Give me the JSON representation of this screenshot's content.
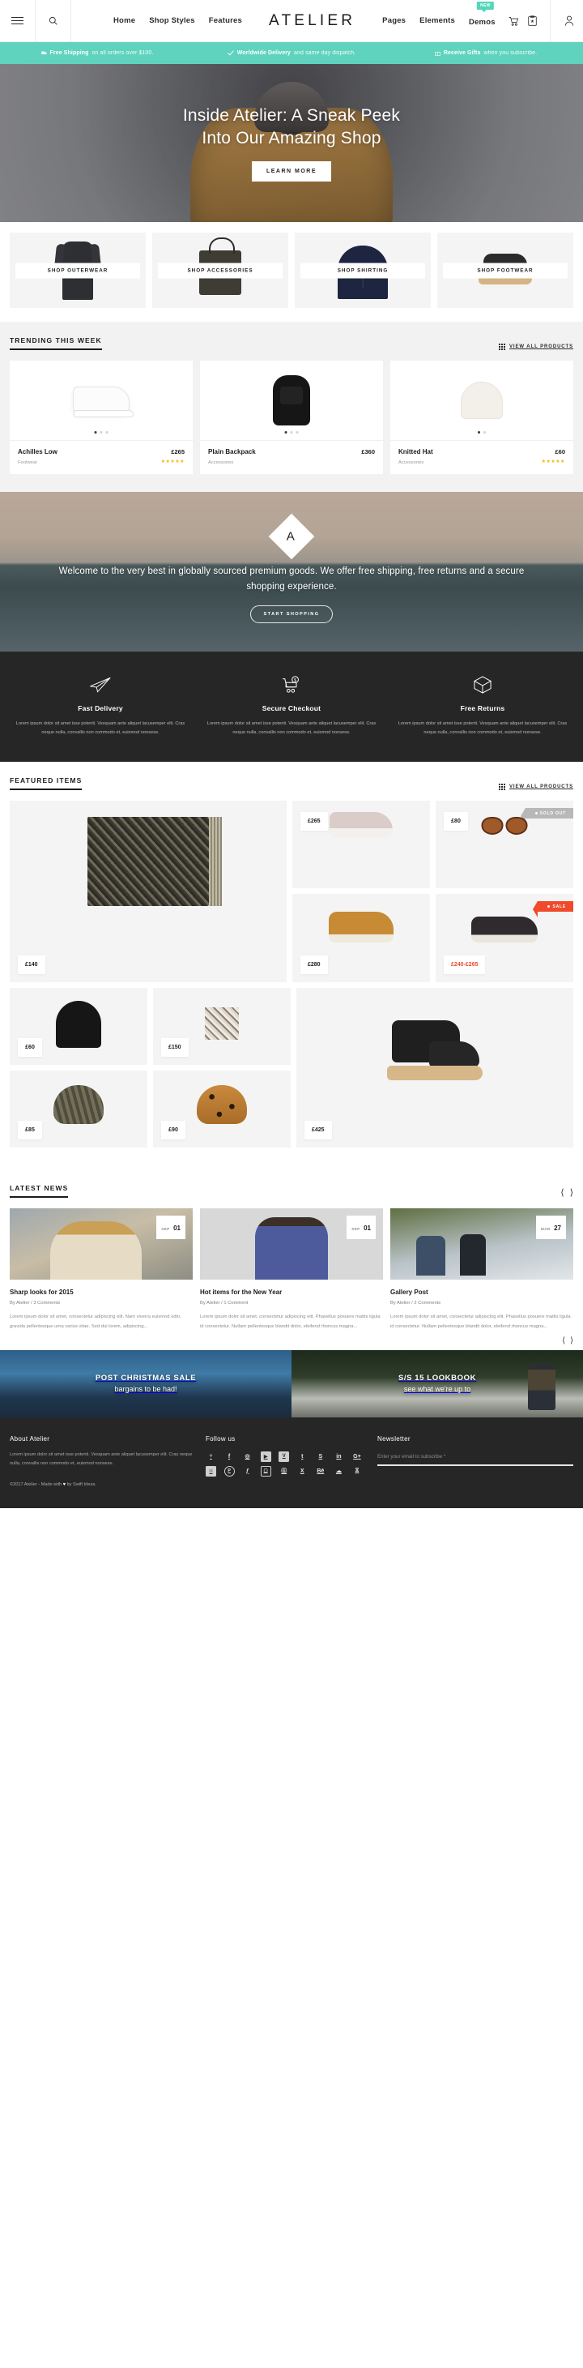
{
  "header": {
    "menu_icon": "hamburger-icon",
    "search_icon": "search-icon",
    "nav": [
      {
        "label": "Home"
      },
      {
        "label": "Shop Styles"
      },
      {
        "label": "Features"
      },
      {
        "label": "Pages"
      },
      {
        "label": "Elements"
      },
      {
        "label": "Demos",
        "badge": "NEW"
      }
    ],
    "brand": "ATELIER",
    "cart_icon": "shopping-cart-icon",
    "wishlist_icon": "clipboard-star-icon",
    "account_icon": "user-account-icon"
  },
  "promo_strip": {
    "items": [
      {
        "icon": "truck-icon",
        "bold": "Free Shipping",
        "rest": "on all orders over $100."
      },
      {
        "icon": "check-icon",
        "bold": "Worldwide Delivery",
        "rest": "and same day dispatch."
      },
      {
        "icon": "gift-icon",
        "bold": "Receive Gifts",
        "rest": "when you subscribe."
      }
    ]
  },
  "hero": {
    "line1": "Inside Atelier: A Sneak Peek",
    "line2": "Into Our Amazing Shop",
    "button": "LEARN MORE"
  },
  "categories": [
    {
      "label": "SHOP OUTERWEAR",
      "art": "coat"
    },
    {
      "label": "SHOP ACCESSORIES",
      "art": "bag"
    },
    {
      "label": "SHOP SHIRTING",
      "art": "shirt"
    },
    {
      "label": "SHOP FOOTWEAR",
      "art": "boot"
    }
  ],
  "trending": {
    "title": "TRENDING THIS WEEK",
    "action": "VIEW ALL PRODUCTS",
    "products": [
      {
        "name": "Achilles Low",
        "price": "£265",
        "category": "Footwear",
        "stars": "★★★★★",
        "dots": 3,
        "active_dot": 0
      },
      {
        "name": "Plain Backpack",
        "price": "£360",
        "category": "Accessories",
        "stars": "",
        "dots": 3,
        "active_dot": 0
      },
      {
        "name": "Knitted Hat",
        "price": "£60",
        "category": "Accessories",
        "stars": "★★★★★",
        "dots": 2,
        "active_dot": 0
      }
    ]
  },
  "welcome": {
    "logo_letter": "A",
    "text": "Welcome to the very best in globally sourced premium goods. We offer free shipping, free returns and a secure shopping experience.",
    "button": "START SHOPPING"
  },
  "features": [
    {
      "icon": "paper-plane-icon",
      "title": "Fast Delivery",
      "body": "Lorem ipsum dolor sit amet isse potenti. Vesquam ante aliquet lacusemper elit. Cras neque nulla, convallis non commodo et, euismod nonsese."
    },
    {
      "icon": "secure-cart-icon",
      "title": "Secure Checkout",
      "body": "Lorem ipsum dolor sit amet isse potenti. Vesquam ante aliquet lacusemper elit. Cras neque nulla, convallis non commodo et, euismod nonsese."
    },
    {
      "icon": "open-box-icon",
      "title": "Free Returns",
      "body": "Lorem ipsum dolor sit amet isse potenti. Vesquam ante aliquet lacusemper elit. Cras neque nulla, convallis non commodo et, euismod nonsese."
    }
  ],
  "featured": {
    "title": "FEATURED ITEMS",
    "action": "VIEW ALL PRODUCTS",
    "items": [
      {
        "price": "£140",
        "art": "scarf",
        "badge": null
      },
      {
        "price": "£265",
        "art": "slipon",
        "badge": null
      },
      {
        "price": "£80",
        "art": "sunglasses",
        "badge": "SOLD OUT"
      },
      {
        "price": "£280",
        "art": "chukka",
        "badge": null
      },
      {
        "price": "£240-£265",
        "art": "dark-sneaker",
        "badge": "SALE",
        "on_sale": true
      },
      {
        "price": "£60",
        "art": "beanie",
        "badge": null
      },
      {
        "price": "£150",
        "art": "snakeskin",
        "badge": null
      },
      {
        "price": "£425",
        "art": "hiking-boot",
        "badge": null
      },
      {
        "price": "£85",
        "art": "bucket-hat",
        "badge": null
      },
      {
        "price": "£90",
        "art": "leopard-hat",
        "badge": null
      }
    ]
  },
  "news": {
    "title": "LATEST NEWS",
    "prev_icon": "chevron-left-icon",
    "next_icon": "chevron-right-icon",
    "posts": [
      {
        "month": "SEP",
        "day": "01",
        "title": "Sharp looks for 2015",
        "meta": "By Atelier / 3 Comments",
        "excerpt": "Lorem ipsum dolor sit amet, consectetur adipiscing elit. Nam viverra euismod odio, gravida pellentesque urna varius vitae. Sed dui lorem, adipiscing..."
      },
      {
        "month": "SEP",
        "day": "01",
        "title": "Hot items for the New Year",
        "meta": "By Atelier / 1 Comment",
        "excerpt": "Lorem ipsum dolor sit amet, consectetur adipiscing elit. Phasellus posuere mattis ligula id consectetur. Nullam pellentesque blandit dolor, eleifend rhoncus magna..."
      },
      {
        "month": "MAR",
        "day": "27",
        "title": "Gallery Post",
        "meta": "By Atelier / 2 Comments",
        "excerpt": "Lorem ipsum dolor sit amet, consectetur adipiscing elit. Phasellus posuere mattis ligula id consectetur. Nullam pellentesque blandit dolor, eleifend rhoncus magna..."
      }
    ]
  },
  "banners": [
    {
      "title": "POST CHRISTMAS SALE",
      "subtitle": "bargains to be had!"
    },
    {
      "title": "S/S 15 LOOKBOOK",
      "subtitle": "see what we're up to"
    }
  ],
  "footer": {
    "about_heading": "About Atelier",
    "about_text": "Lorem ipsum dolor sit amet isse potenti. Vesquam ante aliquet lacusemper elit. Cras neque nulla, convallis non commodo et, euismod nonsese.",
    "copyright_pre": "©2017 Atelier - Made with ",
    "copyright_heart": "♥",
    "copyright_post": " by Swift Ideas.",
    "follow_heading": "Follow us",
    "socials": [
      {
        "name": "twitter-icon",
        "glyph": "ᵛ",
        "style": "plain"
      },
      {
        "name": "facebook-icon",
        "glyph": "f",
        "style": "plain"
      },
      {
        "name": "dribbble-icon",
        "glyph": "◎",
        "style": "plain"
      },
      {
        "name": "youtube-icon",
        "glyph": "▶",
        "style": "box"
      },
      {
        "name": "vimeo-icon",
        "glyph": "V",
        "style": "box"
      },
      {
        "name": "tumblr-icon",
        "glyph": "t",
        "style": "plain"
      },
      {
        "name": "skype-icon",
        "glyph": "S",
        "style": "plain"
      },
      {
        "name": "linkedin-icon",
        "glyph": "in",
        "style": "plain"
      },
      {
        "name": "google-plus-icon",
        "glyph": "G+",
        "style": "plain"
      },
      {
        "name": "flickr-icon",
        "glyph": "∷",
        "style": "box"
      },
      {
        "name": "pinterest-icon",
        "glyph": "P",
        "style": "ring"
      },
      {
        "name": "foursquare-icon",
        "glyph": "ƒ",
        "style": "plain"
      },
      {
        "name": "instagram-icon",
        "glyph": "▢",
        "style": "sq"
      },
      {
        "name": "github-icon",
        "glyph": "Ⓖ",
        "style": "plain"
      },
      {
        "name": "xing-icon",
        "glyph": "X",
        "style": "plain"
      },
      {
        "name": "behance-icon",
        "glyph": "Bē",
        "style": "plain"
      },
      {
        "name": "soundcloud-icon",
        "glyph": "☁",
        "style": "plain"
      },
      {
        "name": "rss-icon",
        "glyph": "⧖",
        "style": "plain"
      }
    ],
    "newsletter_heading": "Newsletter",
    "newsletter_placeholder": "Enter your email to subscribe *",
    "newsletter_value": ""
  },
  "colors": {
    "accent_teal": "#5fd3bd",
    "dark": "#262626",
    "sale_red": "#f04a2b",
    "star_gold": "#f6b500"
  }
}
